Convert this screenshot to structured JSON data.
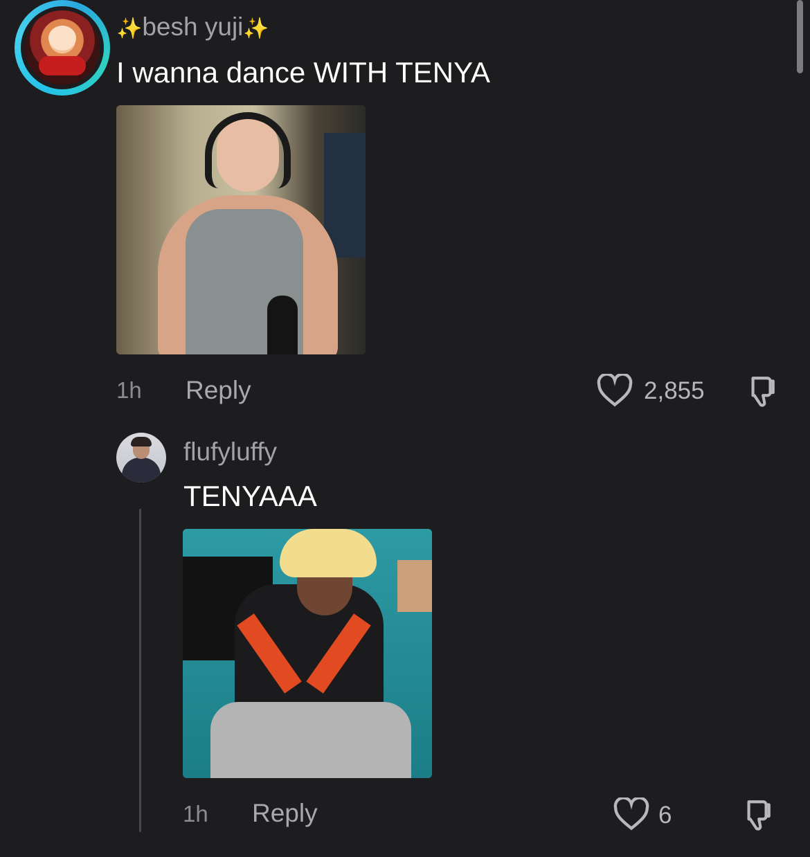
{
  "comment1": {
    "username_prefix": "✨",
    "username": "besh yuji",
    "username_suffix": "✨",
    "text": "I wanna dance WITH TENYA",
    "time": "1h",
    "reply_label": "Reply",
    "likes": "2,855"
  },
  "comment2": {
    "username": "flufyluffy",
    "text": "TENYAAA",
    "time": "1h",
    "reply_label": "Reply",
    "likes": "6"
  },
  "icons": {
    "like": "heart-outline-icon",
    "dislike": "thumbs-down-icon"
  },
  "colors": {
    "background": "#1d1d1f",
    "avatar_ring": "#25c2e8",
    "muted_text": "#a2a2a8"
  }
}
